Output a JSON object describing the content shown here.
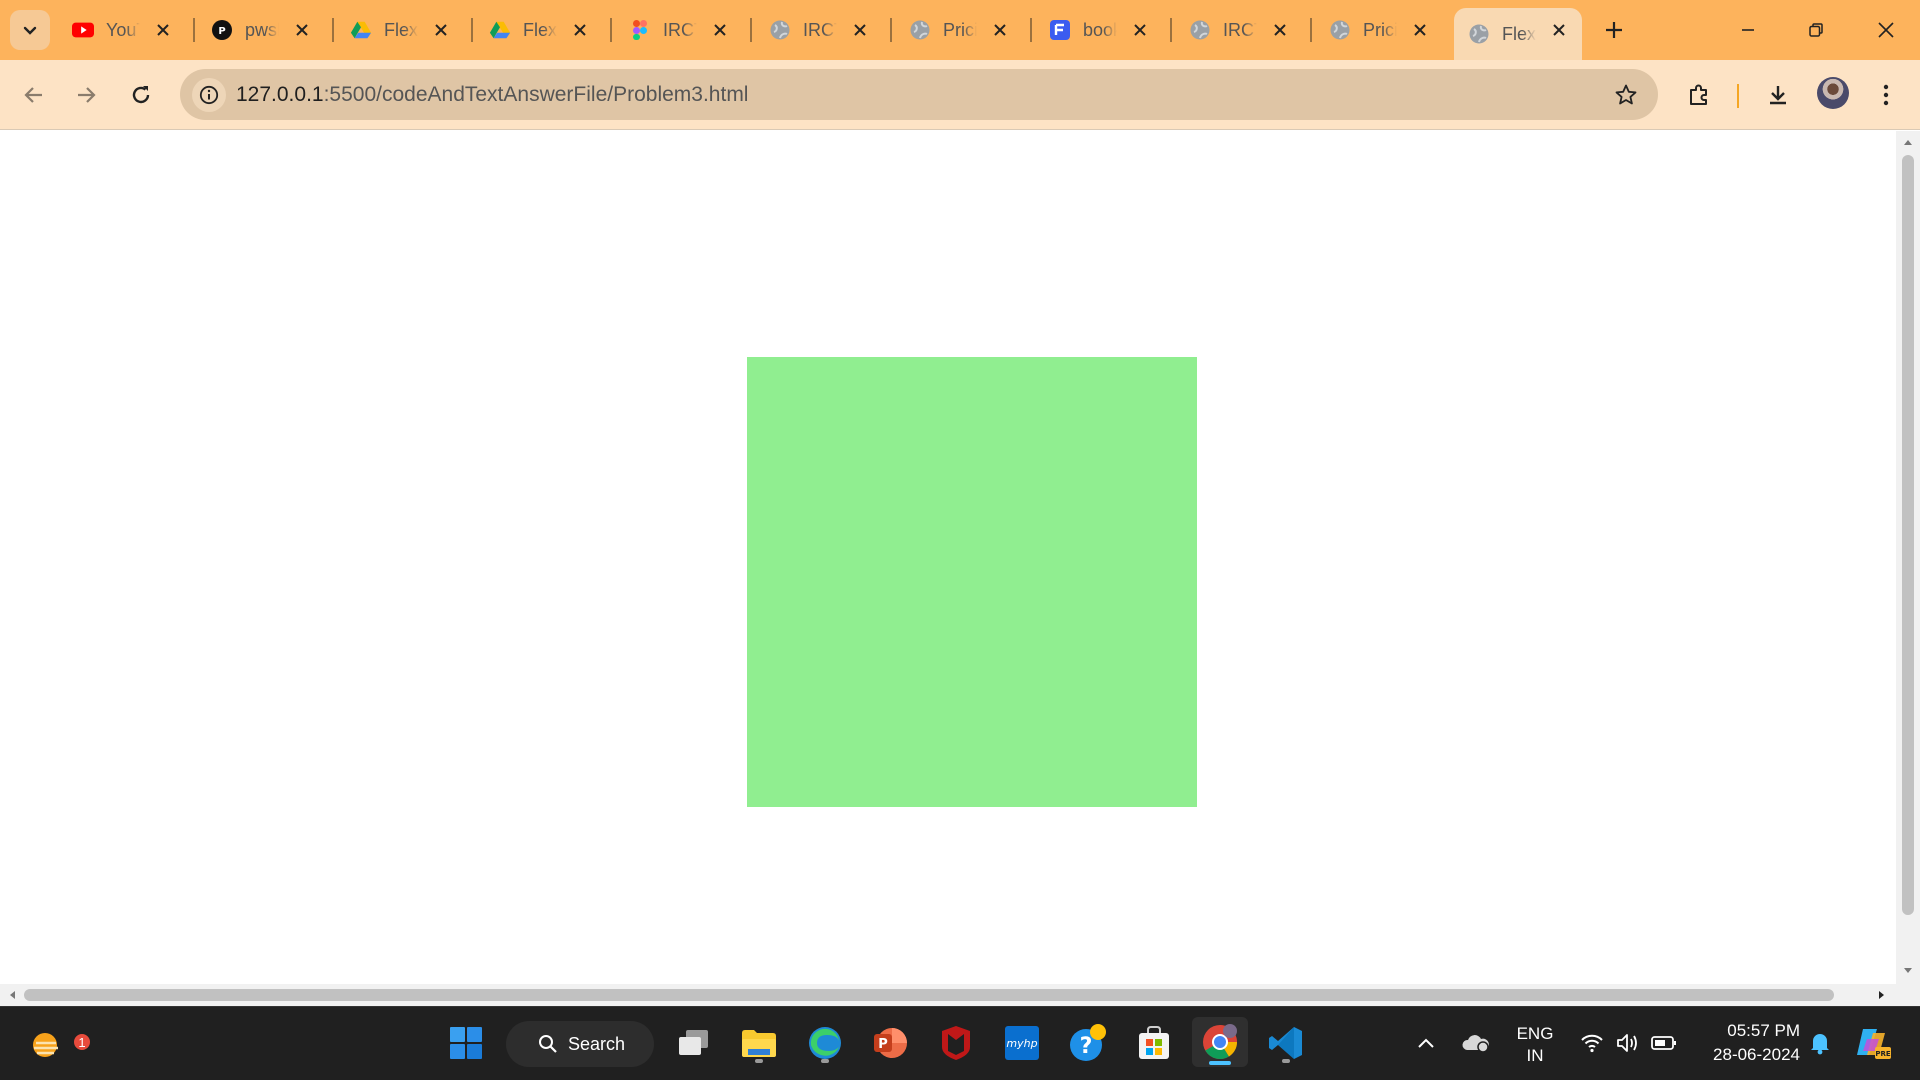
{
  "browser": {
    "tabs": [
      {
        "title": "YouTube",
        "icon": "youtube-icon"
      },
      {
        "title": "pwskills",
        "icon": "pw-icon"
      },
      {
        "title": "Flexbox",
        "icon": "google-drive-icon"
      },
      {
        "title": "Flexbox",
        "icon": "google-drive-icon"
      },
      {
        "title": "IRCTC",
        "icon": "figma-icon"
      },
      {
        "title": "IRCTC",
        "icon": "globe-icon"
      },
      {
        "title": "Pricing",
        "icon": "globe-icon"
      },
      {
        "title": "book",
        "icon": "forms-icon"
      },
      {
        "title": "IRCTC",
        "icon": "globe-icon"
      },
      {
        "title": "Pricing",
        "icon": "globe-icon"
      },
      {
        "title": "Flexbox",
        "icon": "globe-icon"
      }
    ],
    "active_tab_index": 10,
    "address": {
      "host": "127.0.0.1",
      "path": ":5500/codeAndTextAnswerFile/Problem3.html"
    }
  },
  "page": {
    "box_color": "#90ee90"
  },
  "taskbar": {
    "search_label": "Search",
    "notification_badge": "1",
    "language_line1": "ENG",
    "language_line2": "IN",
    "time": "05:57 PM",
    "date": "28-06-2024"
  },
  "colors": {
    "tabstrip": "#fdb35c",
    "toolbar": "#fde3c5",
    "omnibox": "#dfc5a5",
    "taskbar": "#202020"
  }
}
